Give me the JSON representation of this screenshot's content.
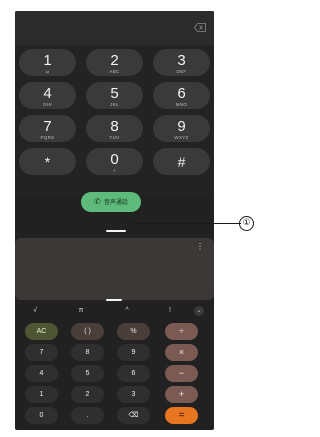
{
  "dialer": {
    "keys": [
      {
        "digit": "1",
        "letters": "ω"
      },
      {
        "digit": "2",
        "letters": "ABC"
      },
      {
        "digit": "3",
        "letters": "DEF"
      },
      {
        "digit": "4",
        "letters": "GHI"
      },
      {
        "digit": "5",
        "letters": "JKL"
      },
      {
        "digit": "6",
        "letters": "MNO"
      },
      {
        "digit": "7",
        "letters": "PQRS"
      },
      {
        "digit": "8",
        "letters": "TUV"
      },
      {
        "digit": "9",
        "letters": "WXYZ"
      },
      {
        "digit": "*",
        "letters": ""
      },
      {
        "digit": "0",
        "letters": "+"
      },
      {
        "digit": "#",
        "letters": ""
      }
    ],
    "call_label": "音声通話",
    "backspace_icon": "backspace-icon",
    "call_icon": "phone-icon"
  },
  "calculator": {
    "more_icon": "more-vert-icon",
    "scientific_keys": [
      "√",
      "π",
      "^",
      "!"
    ],
    "collapse_icon": "chevron-down-icon",
    "keys": [
      [
        "AC",
        "( )",
        "%",
        "÷"
      ],
      [
        "7",
        "8",
        "9",
        "×"
      ],
      [
        "4",
        "5",
        "6",
        "−"
      ],
      [
        "1",
        "2",
        "3",
        "+"
      ],
      [
        "0",
        ".",
        "⌫",
        "="
      ]
    ]
  },
  "callout": {
    "label": "①"
  },
  "colors": {
    "call_button": "#5fbb7c",
    "equals_button": "#e8751f",
    "operator_button": "#7a5a53",
    "clear_button": "#4d5532"
  }
}
